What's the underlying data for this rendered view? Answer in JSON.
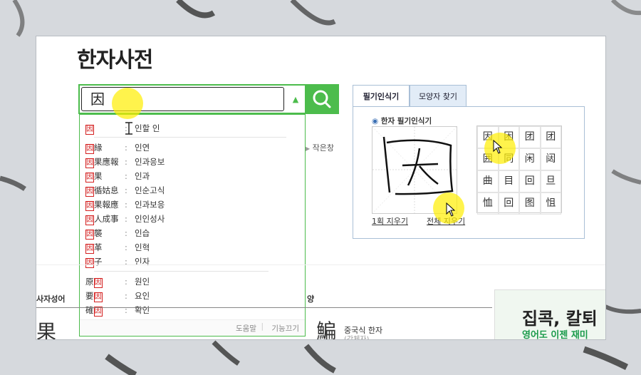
{
  "page": {
    "title": "한자사전"
  },
  "search": {
    "value": "因"
  },
  "suggestions": [
    {
      "word": "因",
      "reading": "인할 인"
    },
    {
      "word": "因緣",
      "reading": "인연"
    },
    {
      "word": "因果應報",
      "reading": "인과응보"
    },
    {
      "word": "因果",
      "reading": "인과"
    },
    {
      "word": "因循姑息",
      "reading": "인순고식"
    },
    {
      "word": "因果報應",
      "reading": "인과보응"
    },
    {
      "word": "因人成事",
      "reading": "인인성사"
    },
    {
      "word": "因襲",
      "reading": "인습"
    },
    {
      "word": "因革",
      "reading": "인혁"
    },
    {
      "word": "因子",
      "reading": "인자"
    },
    {
      "word": "原因",
      "reading": "원인"
    },
    {
      "word": "要因",
      "reading": "요인"
    },
    {
      "word": "確因",
      "reading": "확인"
    }
  ],
  "dropdown_footer": {
    "help": "도움말",
    "off": "기능끄기"
  },
  "handwriting": {
    "tab_active": "필기인식기",
    "tab_inactive": "모양자 찾기",
    "label": "한자 필기인식기",
    "stroke_clear": "1획 지우기",
    "all_clear": "전체 지우기",
    "candidates": [
      "因",
      "困",
      "团",
      "团",
      "囲",
      "同",
      "闲",
      "闼",
      "曲",
      "目",
      "回",
      "旦",
      "恤",
      "回",
      "图",
      "怚"
    ]
  },
  "behind": {
    "small_window": "작은창",
    "section_label": "사자성어",
    "section_label2": "양",
    "big_chars": "果",
    "hanja2": "鯿",
    "chinese_label": "중국식 한자",
    "chinese_sub": "(간체자)",
    "ad_text": "집콕, 칼퇴",
    "ad_sub": "영어도 이젠 재미"
  }
}
